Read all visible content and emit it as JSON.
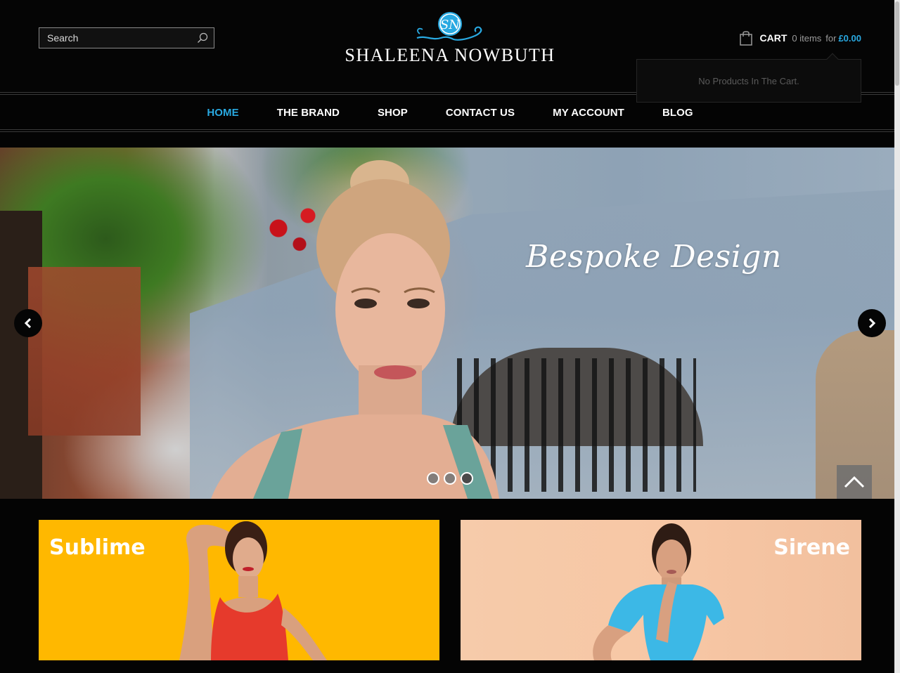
{
  "search": {
    "placeholder": "Search"
  },
  "brand": {
    "monogram": "SN",
    "name": "SHALEENA NOWBUTH"
  },
  "cart": {
    "label": "CART",
    "items": "0 items",
    "for_text": "for",
    "total": "£0.00",
    "empty_message": "No Products In The Cart."
  },
  "nav": {
    "items": [
      {
        "label": "HOME",
        "active": true
      },
      {
        "label": "THE BRAND",
        "active": false
      },
      {
        "label": "SHOP",
        "active": false
      },
      {
        "label": "CONTACT US",
        "active": false
      },
      {
        "label": "MY ACCOUNT",
        "active": false
      },
      {
        "label": "BLOG",
        "active": false
      }
    ]
  },
  "slider": {
    "caption": "Bespoke Design",
    "slide_count": 3,
    "active_slide": 3
  },
  "promos": [
    {
      "title": "Sublime",
      "bg_color": "#ffb800",
      "dress_color": "#e63a2c"
    },
    {
      "title": "Sirene",
      "bg_color": "#f6cbaa",
      "dress_color": "#3cb8e6"
    }
  ],
  "colors": {
    "accent": "#29a9e1",
    "background": "#040404",
    "nav_text": "#ffffff"
  },
  "icons": {
    "search": "search-icon",
    "cart": "shopping-bag-icon",
    "prev": "chevron-left-icon",
    "next": "chevron-right-icon",
    "top": "chevron-up-icon"
  }
}
